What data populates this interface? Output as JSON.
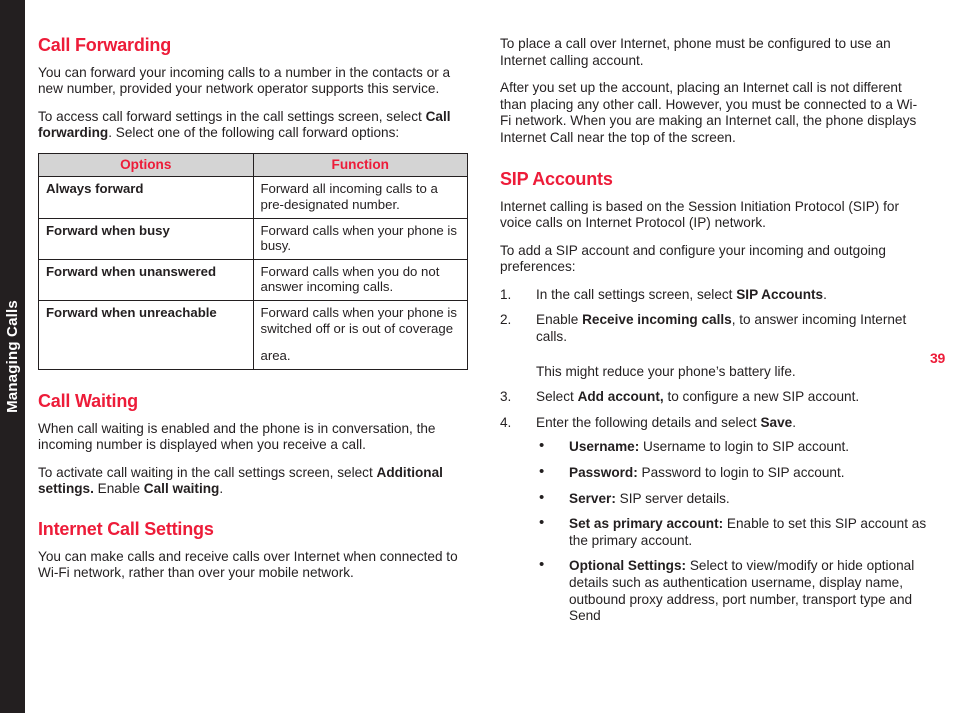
{
  "chapter_tab": {
    "label": "Managing Calls"
  },
  "page_number": "39",
  "colors": {
    "accent_red": "#ed1c39",
    "tab_dark": "#231f20",
    "table_header_bg": "#d4d4d4"
  },
  "left_column": {
    "call_forwarding": {
      "heading": "Call Forwarding",
      "paragraph_1": "You can forward your incoming calls to a number in the contacts or a new number, provided your network operator supports this service.",
      "paragraph_2_part1": "To access call forward settings in the call settings screen, select ",
      "paragraph_2_bold": "Call forwarding",
      "paragraph_2_part2": ". Select one of the following call forward options:"
    },
    "table": {
      "headers": [
        "Options",
        "Function"
      ],
      "rows": [
        {
          "option": "Always forward",
          "function": "Forward all incoming calls to a pre-designated number.",
          "function_extra": ""
        },
        {
          "option": "Forward when busy",
          "function": "Forward calls when your phone is busy.",
          "function_extra": ""
        },
        {
          "option": "Forward when unanswered",
          "function": "Forward calls when you do not answer incoming calls.",
          "function_extra": ""
        },
        {
          "option": "Forward when unreachable",
          "function": "Forward calls when your phone is switched off or is out of coverage",
          "function_extra": "area."
        }
      ]
    },
    "call_waiting": {
      "heading": "Call Waiting",
      "paragraph_1": "When call waiting is enabled and the phone is in conversation, the incoming number is displayed when you receive a call.",
      "paragraph_2_part1": "To activate call waiting in the call settings screen, select ",
      "paragraph_2_bold1": "Additional settings.",
      "paragraph_2_part2": " Enable ",
      "paragraph_2_bold2": "Call waiting",
      "paragraph_2_part3": "."
    },
    "internet_call_settings": {
      "heading": "Internet Call Settings",
      "paragraph_1": "You can make calls and receive calls over Internet when connected to Wi-Fi network, rather than over your mobile network."
    }
  },
  "right_column": {
    "intro_paragraph_1": "To place a call over Internet, phone must be configured to use an Internet calling account.",
    "intro_paragraph_2": "After you set up the account, placing an Internet call is not different than placing any other call. However, you must be connected to a Wi-Fi network. When you are making an Internet call, the phone displays Internet Call near the top of the screen.",
    "sip_accounts": {
      "heading": "SIP Accounts",
      "paragraph_1": "Internet calling is based on the Session Initiation Protocol (SIP) for voice calls on Internet Protocol (IP) network.",
      "paragraph_2": "To add a SIP account and configure your incoming and outgoing preferences:",
      "steps": [
        {
          "number": "1.",
          "text_part1": "In the call settings screen, select ",
          "bold": "SIP Accounts",
          "text_part2": ".",
          "note": ""
        },
        {
          "number": "2.",
          "text_part1": "Enable ",
          "bold": "Receive incoming calls",
          "text_part2": ", to answer incoming Internet calls.",
          "note": "This might reduce your phone’s battery life."
        },
        {
          "number": "3.",
          "text_part1": "Select ",
          "bold": "Add account,",
          "text_part2": " to configure a new SIP account.",
          "note": ""
        },
        {
          "number": "4.",
          "text_part1": "Enter the following details and select ",
          "bold": "Save",
          "text_part2": ".",
          "note": ""
        }
      ],
      "bullets": [
        {
          "bullet": "•",
          "label": "Username:",
          "text": " Username to login to SIP account."
        },
        {
          "bullet": "•",
          "label": "Password:",
          "text": " Password to login to SIP account."
        },
        {
          "bullet": "•",
          "label": "Server:",
          "text": " SIP server details."
        },
        {
          "bullet": "•",
          "label": "Set as primary account:",
          "text": " Enable to set this SIP account as the primary account."
        },
        {
          "bullet": "•",
          "label": "Optional Settings:",
          "text": " Select to view/modify or hide optional details such as authentication username, display name, outbound proxy address, port number, transport type and Send"
        }
      ]
    }
  }
}
